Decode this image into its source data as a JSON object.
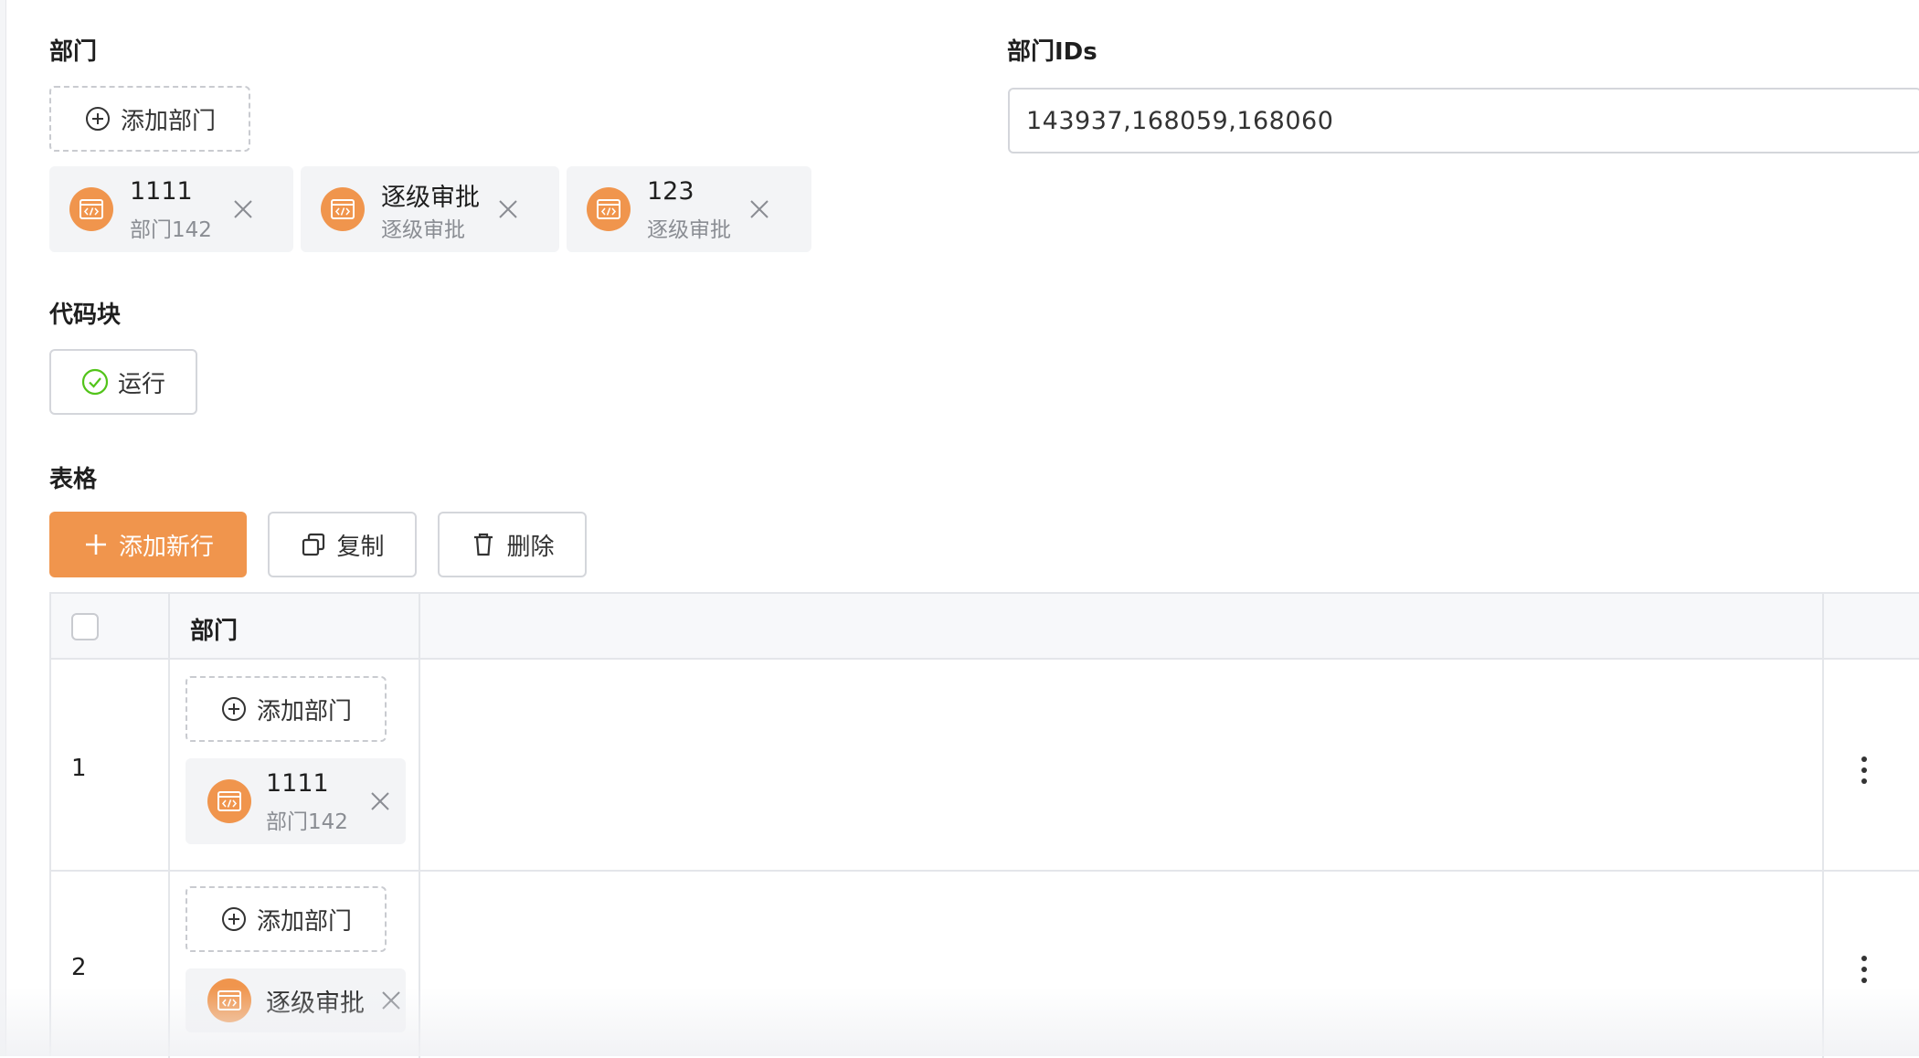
{
  "department_field": {
    "label": "部门",
    "add_label": "添加部门",
    "chips": [
      {
        "title": "1111",
        "sub": "部门142"
      },
      {
        "title": "逐级审批",
        "sub": "逐级审批"
      },
      {
        "title": "123",
        "sub": "逐级审批"
      }
    ]
  },
  "department_ids_field": {
    "label": "部门IDs",
    "value": "143937,168059,168060"
  },
  "code_block": {
    "label": "代码块",
    "run_label": "运行"
  },
  "table_field": {
    "label": "表格",
    "add_row_label": "添加新行",
    "copy_label": "复制",
    "delete_label": "删除",
    "header_department": "部门",
    "rows": [
      {
        "index": "1",
        "add_label": "添加部门",
        "chip": {
          "title": "1111",
          "sub": "部门142"
        }
      },
      {
        "index": "2",
        "add_label": "添加部门",
        "chip": {
          "title": "逐级审批"
        }
      }
    ]
  },
  "colors": {
    "accent": "#f0954d",
    "success": "#52c41a",
    "chip_bg": "#f3f4f6"
  },
  "icons": {
    "add": "plus-circle-icon",
    "chip": "code-icon",
    "close": "close-icon",
    "run": "check-circle-icon",
    "plus": "plus-icon",
    "copy": "copy-icon",
    "delete": "trash-icon",
    "more": "more-vertical-icon"
  }
}
